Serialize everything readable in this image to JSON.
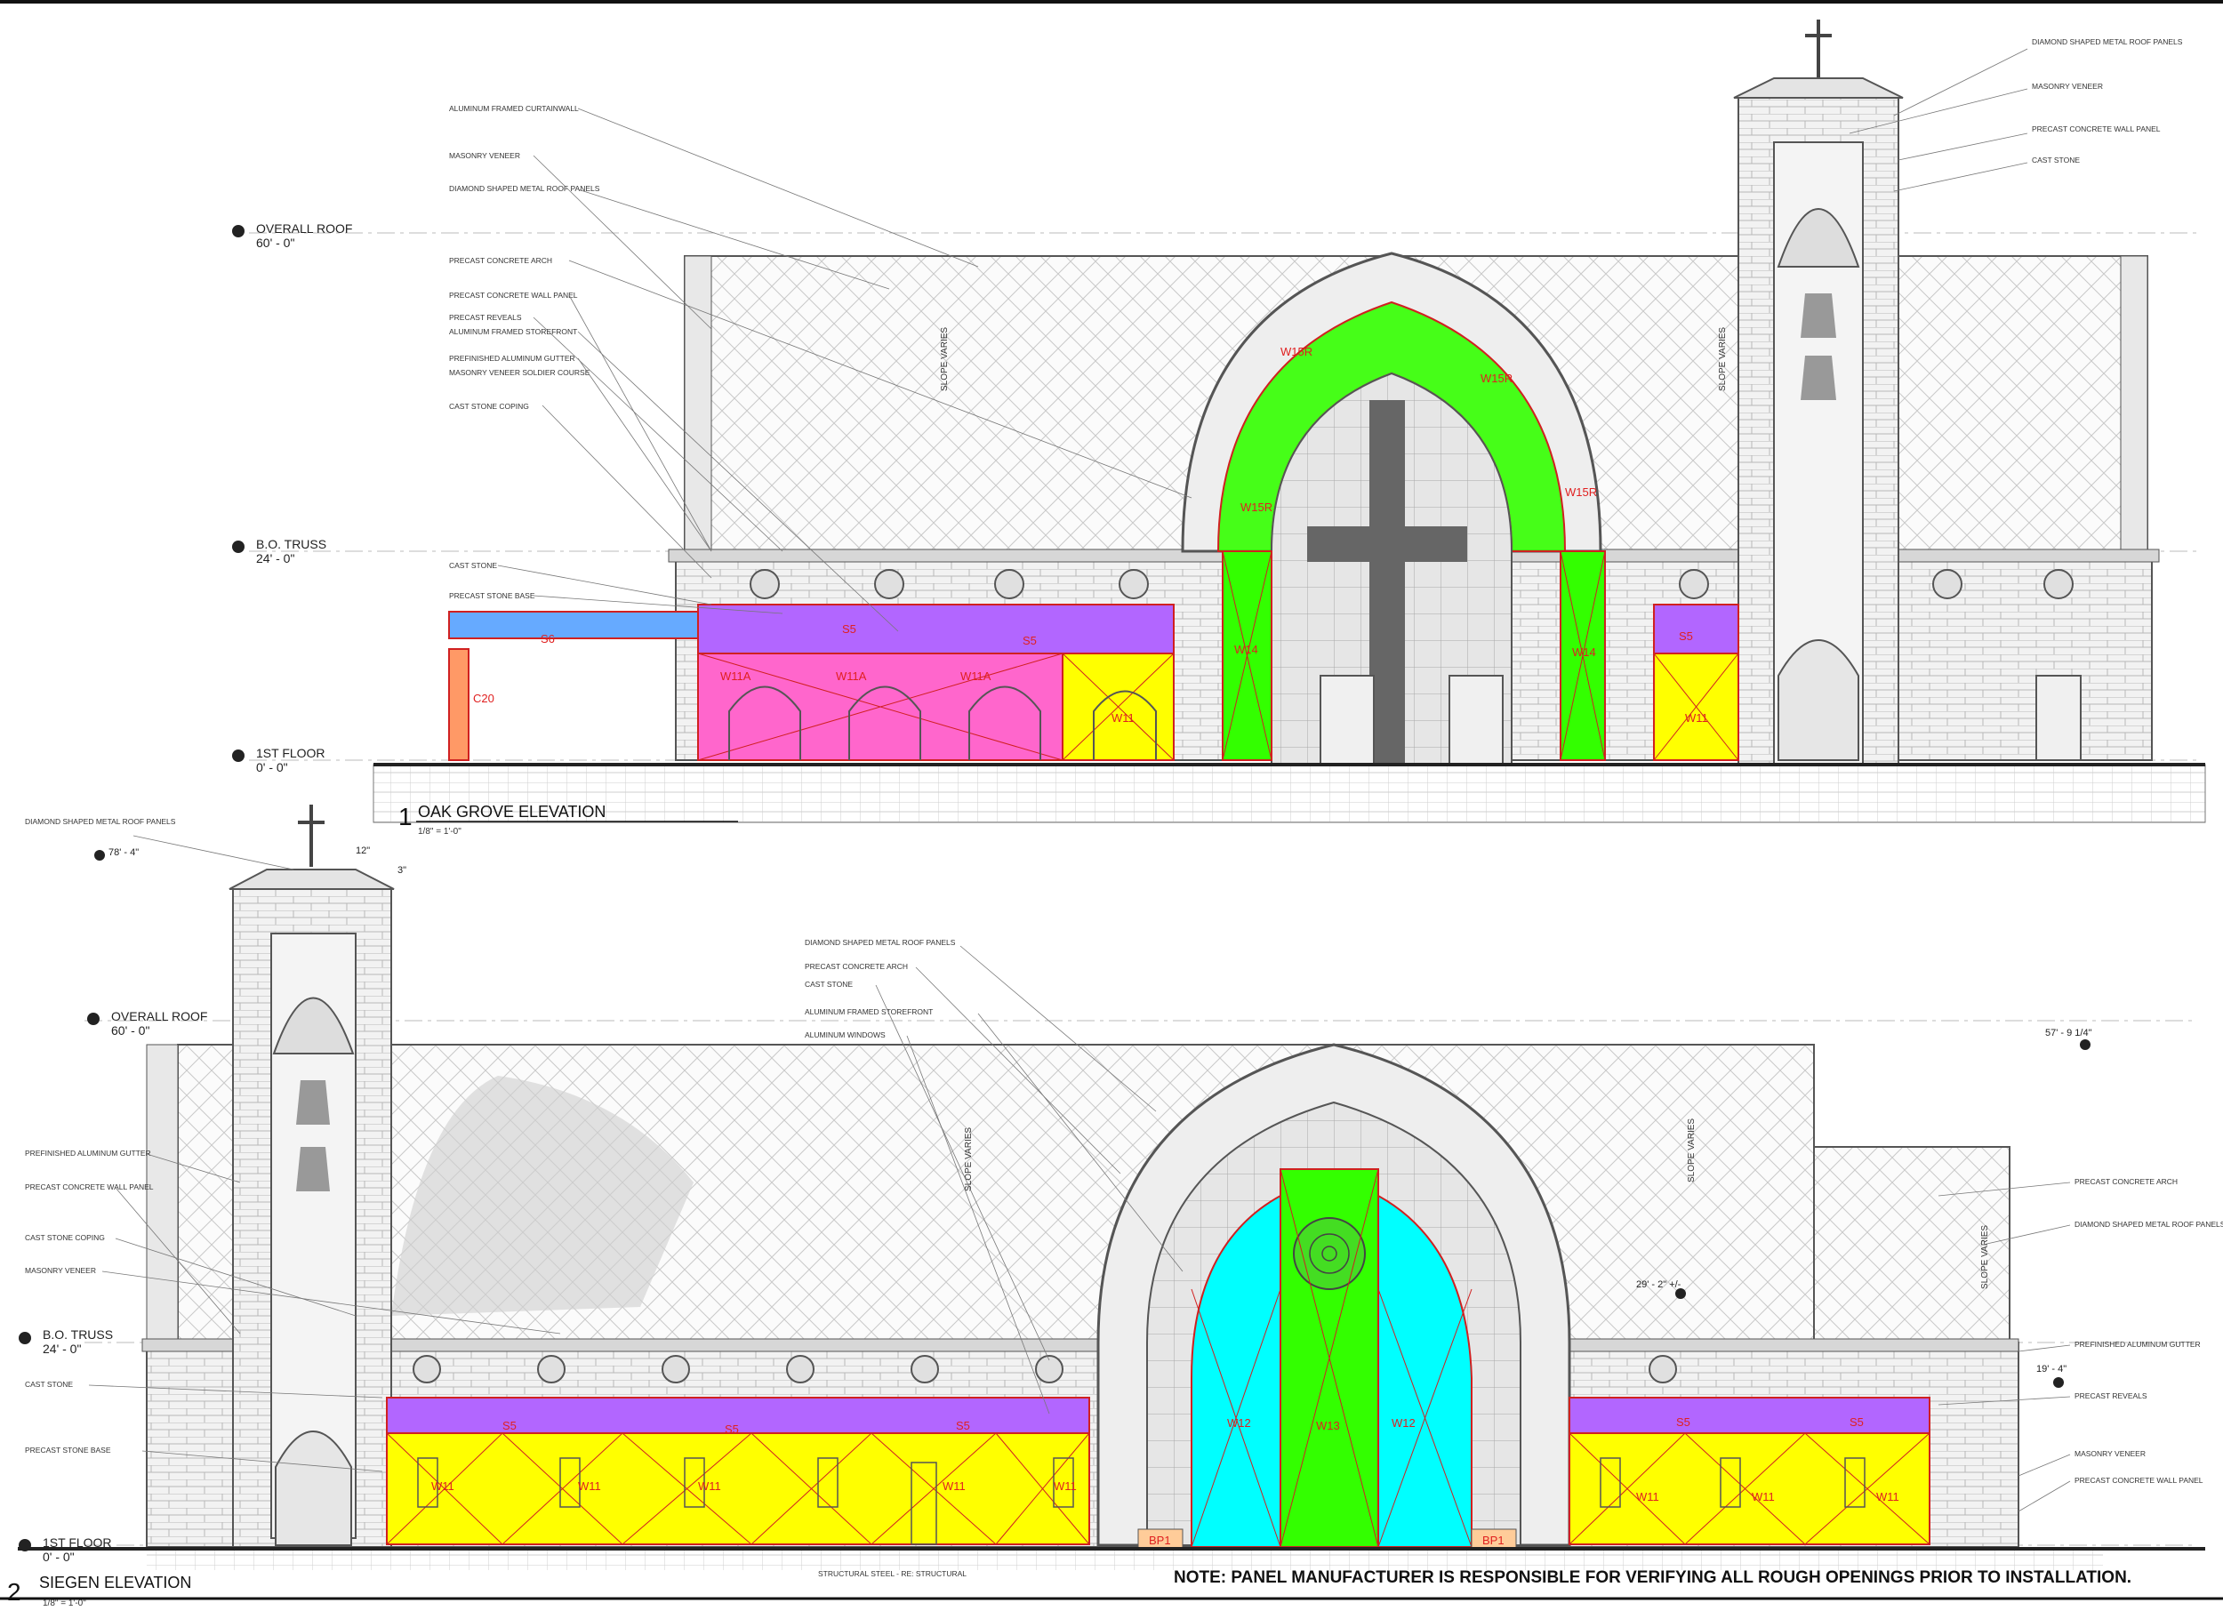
{
  "elevation1": {
    "number": "1",
    "title": "OAK GROVE ELEVATION",
    "scale": "1/8\" = 1'-0\"",
    "levels": [
      {
        "name": "OVERALL ROOF",
        "value": "60' - 0\""
      },
      {
        "name": "B.O. TRUSS",
        "value": "24' - 0\""
      },
      {
        "name": "1ST FLOOR",
        "value": "0' - 0\""
      }
    ],
    "callouts_left": [
      "ALUMINUM FRAMED CURTAINWALL",
      "MASONRY VENEER",
      "DIAMOND SHAPED METAL ROOF PANELS",
      "PRECAST CONCRETE ARCH",
      "PRECAST CONCRETE WALL PANEL",
      "PRECAST REVEALS",
      "ALUMINUM FRAMED STOREFRONT",
      "PREFINISHED ALUMINUM GUTTER",
      "MASONRY VENEER SOLDIER COURSE",
      "CAST STONE COPING",
      "CAST STONE",
      "PRECAST STONE BASE"
    ],
    "callouts_right": [
      "DIAMOND SHAPED METAL ROOF PANELS",
      "MASONRY VENEER",
      "PRECAST CONCRETE WALL PANEL",
      "CAST STONE"
    ],
    "slope_note": "SLOPE VARIES",
    "tags": {
      "w15r": "W15R",
      "w14": "W14",
      "w11a": "W11A",
      "w11": "W11",
      "s5": "S5",
      "s6": "S6",
      "c20": "C20"
    }
  },
  "elevation2": {
    "number": "2",
    "title": "SIEGEN ELEVATION",
    "scale": "1/8\" = 1'-0\"",
    "levels": [
      {
        "name": "OVERALL ROOF",
        "value": "60' - 0\""
      },
      {
        "name": "B.O. TRUSS",
        "value": "24' - 0\""
      },
      {
        "name": "1ST FLOOR",
        "value": "0' - 0\""
      }
    ],
    "spot_elevations": {
      "tower": "78' - 4\"",
      "ridge": "57' - 9 1/4\"",
      "mid": "29' - 2\" +/-",
      "low": "19' - 4\""
    },
    "dims": {
      "twelve": "12\"",
      "three": "3\""
    },
    "callouts_left": [
      "DIAMOND SHAPED METAL ROOF PANELS",
      "PREFINISHED ALUMINUM GUTTER",
      "PRECAST CONCRETE WALL PANEL",
      "CAST STONE COPING",
      "MASONRY VENEER",
      "CAST STONE",
      "PRECAST STONE BASE"
    ],
    "callouts_center": [
      "DIAMOND SHAPED METAL ROOF PANELS",
      "PRECAST CONCRETE ARCH",
      "CAST STONE",
      "ALUMINUM FRAMED STOREFRONT",
      "ALUMINUM WINDOWS"
    ],
    "callouts_right": [
      "PRECAST CONCRETE ARCH",
      "DIAMOND SHAPED METAL ROOF PANELS",
      "PREFINISHED ALUMINUM GUTTER",
      "PRECAST REVEALS",
      "MASONRY VENEER",
      "PRECAST CONCRETE WALL PANEL"
    ],
    "structural_note": "STRUCTURAL STEEL - RE: STRUCTURAL",
    "slope_note": "SLOPE VARIES",
    "tags": {
      "w11": "W11",
      "w12": "W12",
      "w13": "W13",
      "s5": "S5",
      "bp1": "BP1"
    }
  },
  "footer_note": "NOTE: PANEL MANUFACTURER IS RESPONSIBLE FOR VERIFYING ALL ROUGH OPENINGS PRIOR TO INSTALLATION.",
  "colors": {
    "green": "#33ff00",
    "magenta": "#ff66cc",
    "yellow": "#ffff00",
    "purple": "#b266ff",
    "blue": "#66aaff",
    "cyan": "#00ffff",
    "orange": "#ff9966",
    "tag_red": "#e02020"
  }
}
